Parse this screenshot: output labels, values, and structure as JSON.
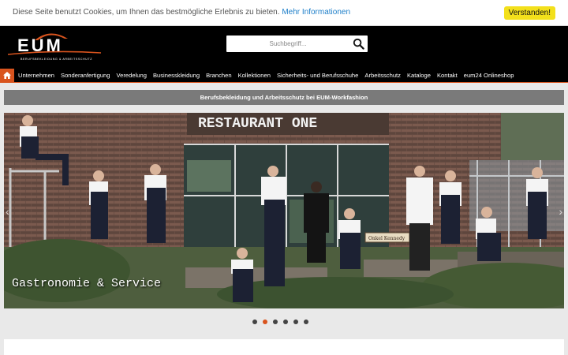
{
  "cookie": {
    "text": "Diese Seite benutzt Cookies, um Ihnen das bestmögliche Erlebnis zu bieten.",
    "link": "Mehr Informationen",
    "accept": "Verstanden!"
  },
  "logo": {
    "name": "EUM",
    "tagline": "BERUFSBEKLEIDUNG & ARBEITSSCHUTZ"
  },
  "search": {
    "placeholder": "Suchbegriff..."
  },
  "nav": {
    "items": [
      "Unternehmen",
      "Sonderanfertigung",
      "Veredelung",
      "Businesskleidung",
      "Branchen",
      "Kollektionen",
      "Sicherheits- und Berufsschuhe",
      "Arbeitsschutz",
      "Kataloge",
      "Kontakt",
      "eum24 Onlineshop"
    ]
  },
  "strip": {
    "text": "Berufsbekleidung und Arbeitsschutz bei EUM-Workfashion"
  },
  "hero": {
    "sign": "RESTAURANT ONE",
    "small_sign": "Onkel Kennedy",
    "caption": "Gastronomie & Service",
    "slides_total": 6,
    "active_slide": 2
  },
  "colors": {
    "accent": "#d9541e",
    "cookie_button": "#f3e01b",
    "link": "#1e7fc9"
  }
}
